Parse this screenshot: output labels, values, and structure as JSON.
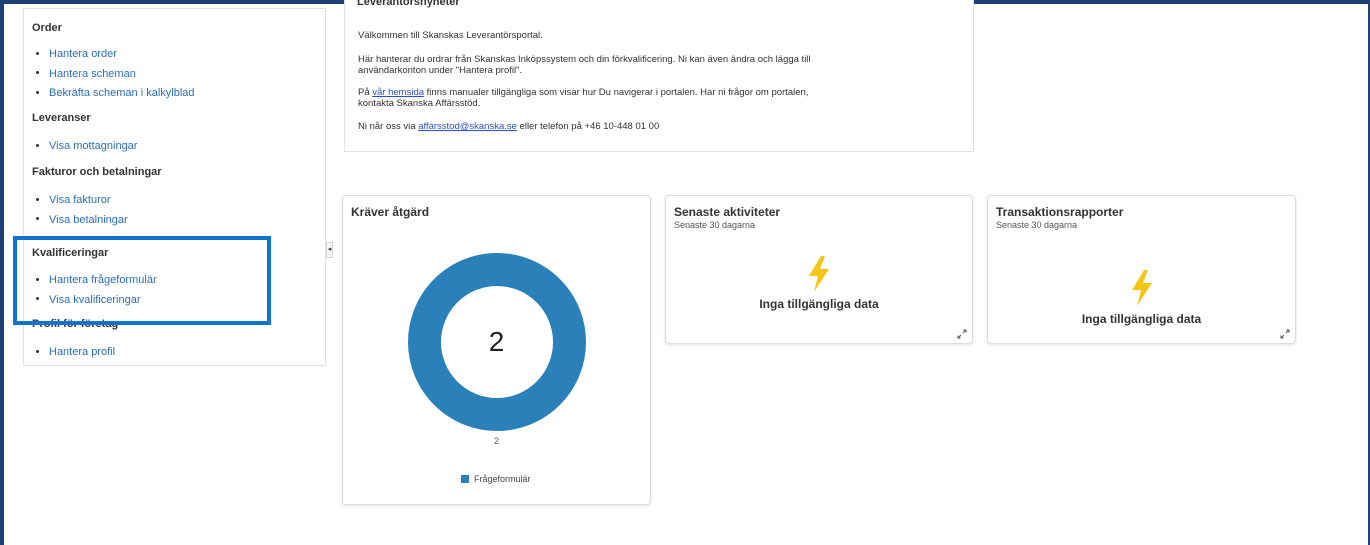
{
  "sidebar": {
    "sections": [
      {
        "title": "Order",
        "items": [
          "Hantera order",
          "Hantera scheman",
          "Bekräfta scheman i kalkylblad"
        ]
      },
      {
        "title": "Leveranser",
        "items": [
          "Visa mottagningar"
        ]
      },
      {
        "title": "Fakturor och betalningar",
        "items": [
          "Visa fakturor",
          "Visa betalningar"
        ]
      },
      {
        "title": "Kvalificeringar",
        "items": [
          "Hantera frågeformulär",
          "Visa kvalificeringar"
        ]
      },
      {
        "title": "Profil för företag",
        "items": [
          "Hantera profil"
        ]
      }
    ],
    "collapse_glyph": "◂"
  },
  "news": {
    "title": "Leverantörsnyheter",
    "welcome": "Välkommen till Skanskas Leverantörsportal.",
    "line2a": "Här hanterar du ordrar från Skanskas Inköpssystem och din förkvalificering. Ni kan även ändra och lägga till",
    "line2b": "användarkonton under \"Hantera profil\".",
    "line3_pre": "På ",
    "line3_link": "vår hemsida",
    "line3a_post": " finns manualer tillgängliga som visar hur Du navigerar i portalen. Har ni frågor om portalen,",
    "line3b": "kontakta Skanska Affärsstöd.",
    "line4_pre": "Ni når oss via ",
    "line4_link": "affarsstod@skanska.se",
    "line4_post": " eller telefon på +46 10-448 01 00"
  },
  "cards": {
    "action": {
      "title": "Kräver åtgärd",
      "center_value": "2",
      "slice_label": "2",
      "legend": "Frågeformulär"
    },
    "activity": {
      "title": "Senaste aktiviteter",
      "subtitle": "Senaste 30 dagarna",
      "empty": "Inga tillgängliga data"
    },
    "reports": {
      "title": "Transaktionsrapporter",
      "subtitle": "Senaste 30 dagarna",
      "empty": "Inga tillgängliga data"
    }
  },
  "chart_data": {
    "type": "pie",
    "categories": [
      "Frågeformulär"
    ],
    "values": [
      2
    ],
    "title": "Kräver åtgärd"
  },
  "colors": {
    "accent": "#2a80b9",
    "link": "#2a6ebb",
    "highlight": "#0b74d0",
    "bolt": "#f5c518"
  }
}
